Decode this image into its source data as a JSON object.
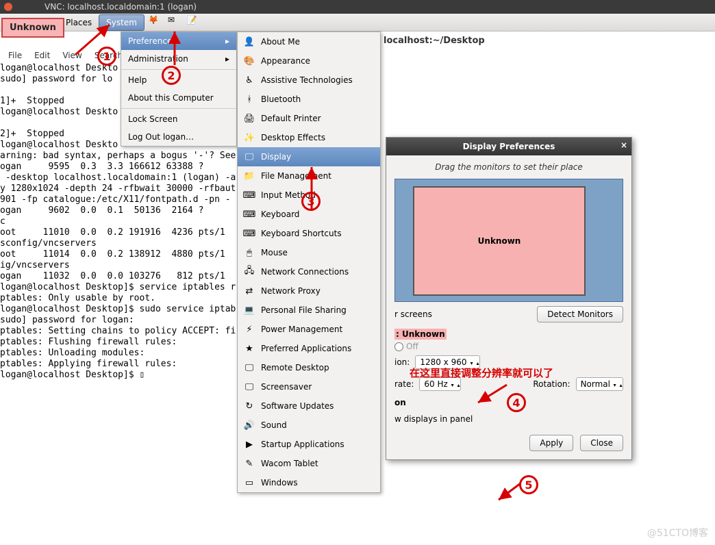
{
  "vnc_title": "VNC: localhost.localdomain:1 (logan)",
  "unknown_badge": "Unknown",
  "panel": {
    "places": "Places",
    "system": "System"
  },
  "breadcrumb": "localhost:~/Desktop",
  "term_menu": [
    "File",
    "Edit",
    "View",
    "Search"
  ],
  "terminal": "logan@localhost Deskto\nsudo] password for lo\n\n1]+  Stopped\nlogan@localhost Deskto\n\n2]+  Stopped\nlogan@localhost Deskto\narning: bad syntax, perhaps a bogus '-'? See\nogan     9595  0.3  3.3 166612 63388 ?\n -desktop localhost.localdomain:1 (logan) -a\ny 1280x1024 -depth 24 -rfbwait 30000 -rfbaut\n901 -fp catalogue:/etc/X11/fontpath.d -pn -\nogan     9602  0.0  0.1  50136  2164 ?\nc\noot     11010  0.0  0.2 191916  4236 pts/1\nsconfig/vncservers\noot     11014  0.0  0.2 138912  4880 pts/1\nig/vncservers\nogan    11032  0.0  0.0 103276   812 pts/1\nlogan@localhost Desktop]$ service iptables r\nptables: Only usable by root.\nlogan@localhost Desktop]$ sudo service iptab\nsudo] password for logan:\nptables: Setting chains to policy ACCEPT: fi\nptables: Flushing firewall rules:\nptables: Unloading modules:\nptables: Applying firewall rules:\nlogan@localhost Desktop]$ ▯",
  "sysmenu": {
    "preferences": "Preferences",
    "administration": "Administration",
    "help": "Help",
    "about_computer": "About this Computer",
    "lock_screen": "Lock Screen",
    "logout": "Log Out logan…"
  },
  "prefs": [
    {
      "icon": "👤",
      "label": "About Me"
    },
    {
      "icon": "🎨",
      "label": "Appearance"
    },
    {
      "icon": "♿",
      "label": "Assistive Technologies"
    },
    {
      "icon": "ᚼ",
      "label": "Bluetooth"
    },
    {
      "icon": "🖨",
      "label": "Default Printer"
    },
    {
      "icon": "✨",
      "label": "Desktop Effects"
    },
    {
      "icon": "🖵",
      "label": "Display",
      "sel": true
    },
    {
      "icon": "📁",
      "label": "File Management"
    },
    {
      "icon": "⌨",
      "label": "Input Method"
    },
    {
      "icon": "⌨",
      "label": "Keyboard"
    },
    {
      "icon": "⌨",
      "label": "Keyboard Shortcuts"
    },
    {
      "icon": "🖱",
      "label": "Mouse"
    },
    {
      "icon": "🖧",
      "label": "Network Connections"
    },
    {
      "icon": "⇄",
      "label": "Network Proxy"
    },
    {
      "icon": "💻",
      "label": "Personal File Sharing"
    },
    {
      "icon": "⚡",
      "label": "Power Management"
    },
    {
      "icon": "★",
      "label": "Preferred Applications"
    },
    {
      "icon": "🖵",
      "label": "Remote Desktop"
    },
    {
      "icon": "🖵",
      "label": "Screensaver"
    },
    {
      "icon": "↻",
      "label": "Software Updates"
    },
    {
      "icon": "🔊",
      "label": "Sound"
    },
    {
      "icon": "▶",
      "label": "Startup Applications"
    },
    {
      "icon": "✎",
      "label": "Wacom Tablet"
    },
    {
      "icon": "▭",
      "label": "Windows"
    }
  ],
  "dp": {
    "title": "Display Preferences",
    "hint": "Drag the monitors to set their place",
    "monitor_name": "Unknown",
    "mirror": "r screens",
    "detect": "Detect Monitors",
    "monitor_label": ": Unknown",
    "off": "Off",
    "res_label": "ion:",
    "resolution": "1280 x 960",
    "rate_label": "rate:",
    "rate": "60 Hz",
    "rot_label": "Rotation:",
    "rotation": "Normal",
    "section": "on",
    "show_panel": "w displays in panel",
    "apply": "Apply",
    "close": "Close"
  },
  "annotations": {
    "n1": "1",
    "n2": "2",
    "n3": "3",
    "n4": "4",
    "n5": "5",
    "chinese": "在这里直接调整分辨率就可以了"
  },
  "watermark": "@51CTO博客"
}
